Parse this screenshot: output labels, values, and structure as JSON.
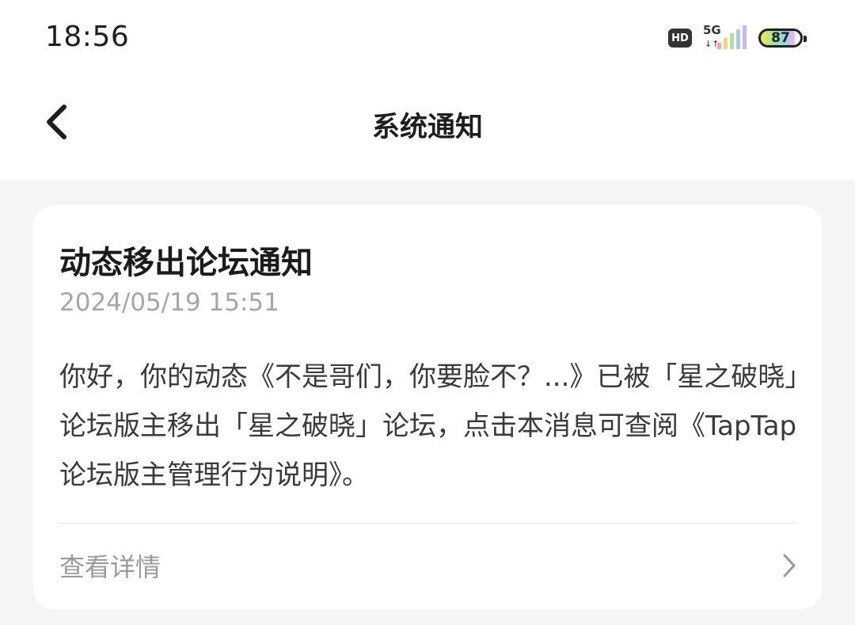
{
  "status_bar": {
    "time": "18:56",
    "hd_label": "HD",
    "network_label": "5G",
    "battery_level": "87",
    "icons": [
      "hd-icon",
      "signal-icon",
      "battery-icon"
    ]
  },
  "nav": {
    "title": "系统通知",
    "back_icon": "chevron-left-icon"
  },
  "notification": {
    "title": "动态移出论坛通知",
    "timestamp": "2024/05/19 15:51",
    "body": "你好，你的动态《不是哥们，你要脸不？...》已被「星之破晓」论坛版主移出「星之破晓」论坛，点击本消息可查阅《TapTap论坛版主管理行为说明》。",
    "detail_label": "查看详情",
    "detail_icon": "chevron-right-icon"
  },
  "colors": {
    "page_background": "#f4f5f7",
    "card_background": "#ffffff",
    "timestamp_text": "#a6a6a6",
    "body_text": "#3a3a3a"
  }
}
